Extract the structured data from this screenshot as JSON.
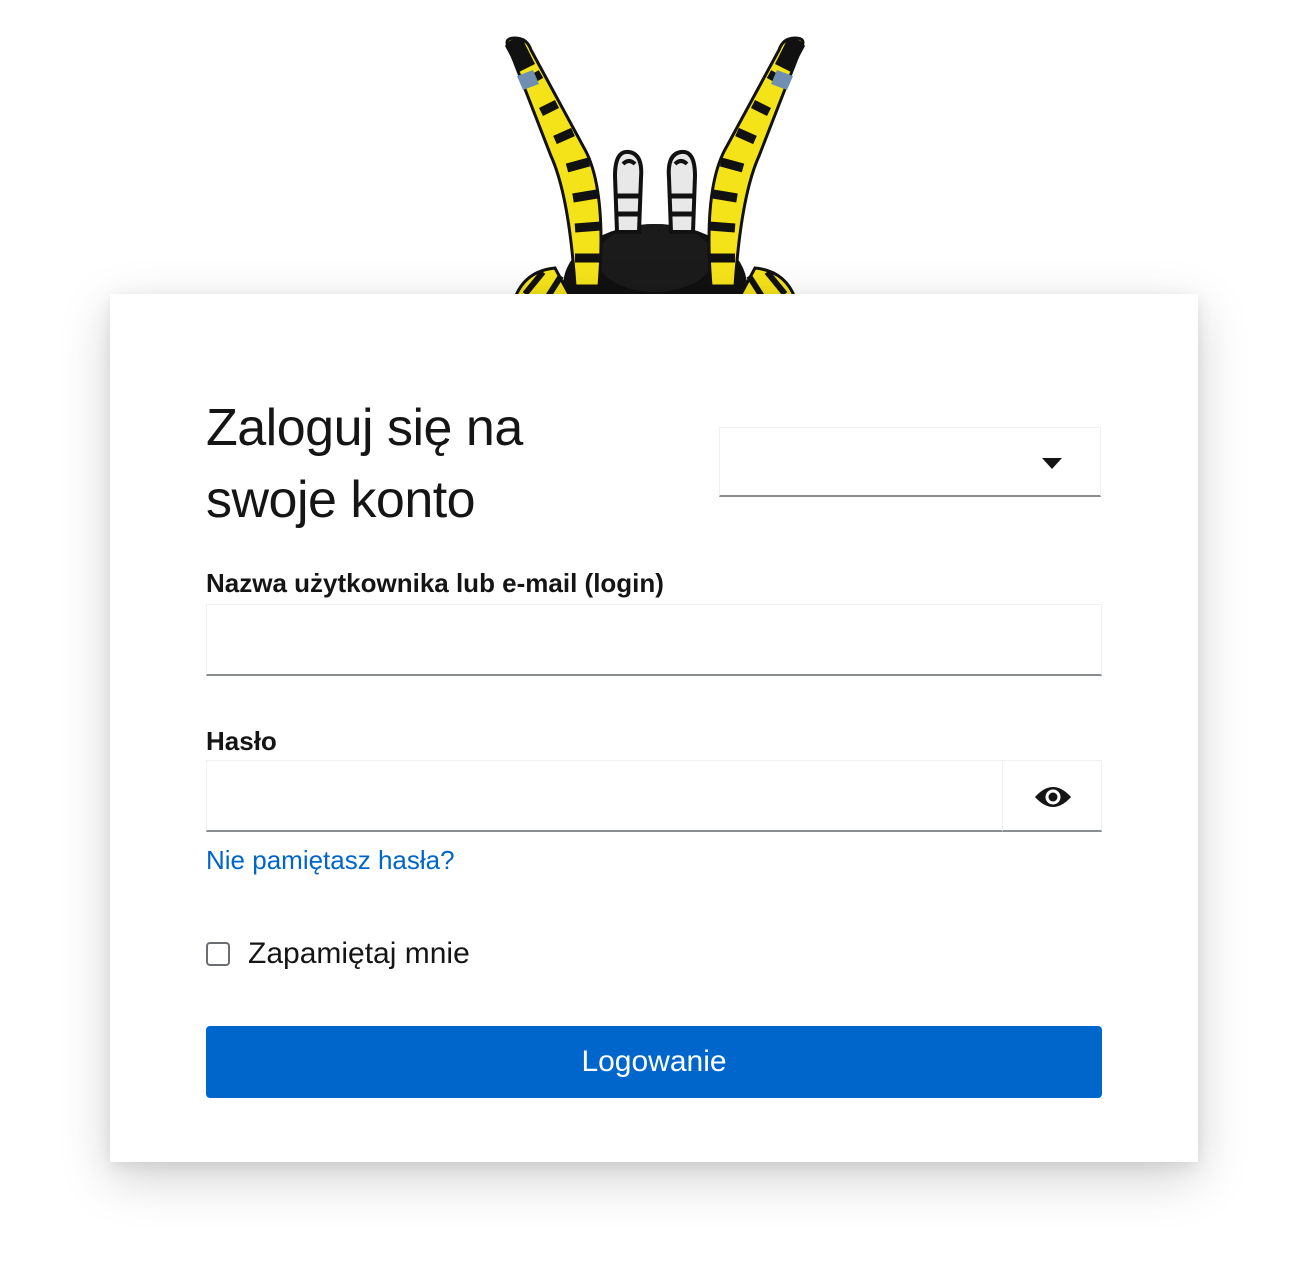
{
  "colors": {
    "primary": "#0066cc",
    "link": "#0066cc",
    "text": "#151515",
    "border": "#8a8d90",
    "logo_yellow": "#f5e31a",
    "logo_black": "#111111"
  },
  "logo": {
    "icon": "spider-legs-logo-icon"
  },
  "login": {
    "title": "Zaloguj się na swoje konto",
    "language_select": {
      "value": "",
      "icon": "caret-down-icon"
    },
    "username_label": "Nazwa użytkownika lub e-mail (login)",
    "username_value": "",
    "password_label": "Hasło",
    "password_value": "",
    "show_password_icon": "eye-icon",
    "forgot_password": "Nie pamiętasz hasła?",
    "remember_me": "Zapamiętaj mnie",
    "remember_me_checked": false,
    "submit": "Logowanie"
  }
}
